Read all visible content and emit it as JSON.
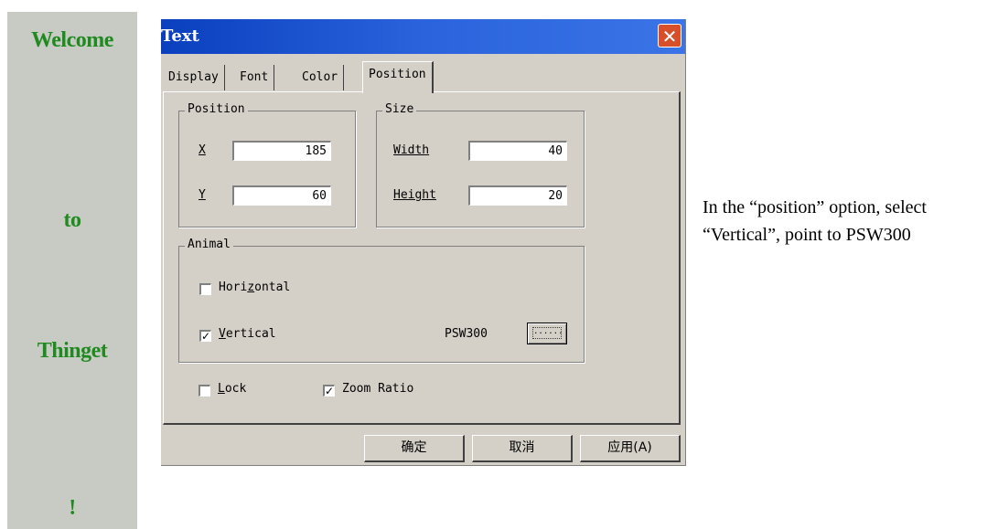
{
  "banner": {
    "words": [
      "Welcome",
      "to",
      "Thinget",
      "!"
    ],
    "background": "#c8cbc4",
    "text_color": "#1f8a1f"
  },
  "dialog": {
    "title": "Text",
    "close_icon": "close-icon",
    "tabs": [
      {
        "label": "Display",
        "active": false
      },
      {
        "label": "Font",
        "active": false
      },
      {
        "label": "Color",
        "active": false
      },
      {
        "label": "Position",
        "active": true
      }
    ],
    "position_group": {
      "label": "Position",
      "x_label": "X",
      "x_value": "185",
      "y_label": "Y",
      "y_value": "60"
    },
    "size_group": {
      "label": "Size",
      "width_label": "Width",
      "width_value": "40",
      "height_label": "Height",
      "height_value": "20"
    },
    "animal_group": {
      "label": "Animal",
      "horizontal_label_pre": "Hori",
      "horizontal_label_u": "z",
      "horizontal_label_post": "ontal",
      "horizontal_checked": false,
      "vertical_label_u": "V",
      "vertical_label_post": "ertical",
      "vertical_checked": true,
      "register": "PSW300",
      "browse_label": "......"
    },
    "lock_label_u": "L",
    "lock_label_post": "ock",
    "lock_checked": false,
    "zoom_label": "Zoom Ratio",
    "zoom_checked": true,
    "buttons": {
      "ok": "确定",
      "cancel": "取消",
      "apply": "应用(A)"
    },
    "title_bar_color": "#2a63dc",
    "face_color": "#d4d0c8"
  },
  "note": {
    "text": "In the “position” option, select “Vertical”, point to PSW300"
  }
}
